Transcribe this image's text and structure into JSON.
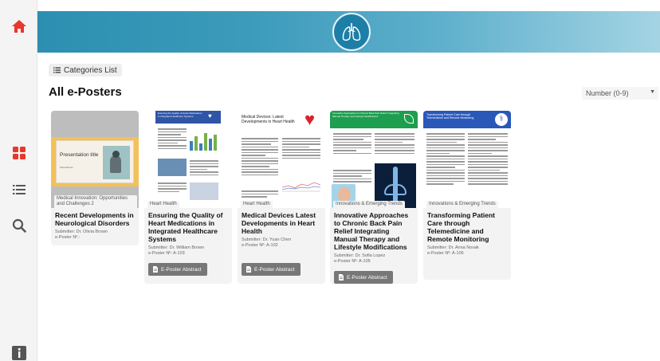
{
  "header": {
    "logo_icon": "lungs-icon"
  },
  "sidebar": {
    "home_icon": "home-icon",
    "grid_icon": "grid-view-icon",
    "list_icon": "list-view-icon",
    "search_icon": "search-icon",
    "info_icon": "info-icon"
  },
  "toolbar": {
    "categories_label": "Categories List"
  },
  "page": {
    "title": "All e-Posters"
  },
  "sort": {
    "selected": "Number (0-9)"
  },
  "posters": [
    {
      "category": "Medical Innovation: Opportunities and Challenges 2",
      "title": "Recent Developments in Neurological Disorders",
      "submitter": "Submitter: Dr. Olivia Brown",
      "number": "e-Poster Nº.:",
      "thumb_title": "Presentation title",
      "thumb_subtitle": "Olivia Brown",
      "has_abstract": false
    },
    {
      "category": "Heart Health",
      "title": "Ensuring the Quality of Heart Medications in Integrated Healthcare Systems",
      "submitter": "Submitter: Dr. William Brown",
      "number": "e-Poster Nº: A-103",
      "thumb_title": "Ensuring the Quality of Heart Medications in Integrated Healthcare Systems",
      "has_abstract": true,
      "abstract_label": "E-Poster Abstract"
    },
    {
      "category": "Heart Health",
      "title": "Medical Devices Latest Developments in Heart Health",
      "submitter": "Submitter: Dr. Yuan Chen",
      "number": "e-Poster Nº: A-102",
      "thumb_title": "Medical Devices: Latest Developments in Heart Health",
      "has_abstract": true,
      "abstract_label": "E-Poster Abstract"
    },
    {
      "category": "Innovations & Emerging Trends",
      "title": "Innovative Approaches to Chronic Back Pain Relief Integrating Manual Therapy and Lifestyle Modifications",
      "submitter": "Submitter: Dr. Sofia Lopez",
      "number": "e-Poster Nº: A-105",
      "thumb_title": "Innovative Approaches to Chronic Back Pain Relief: Integrating Manual Therapy and Lifestyle Modifications",
      "has_abstract": true,
      "abstract_label": "E-Poster Abstract"
    },
    {
      "category": "Innovations & Emerging Trends",
      "title": "Transforming Patient Care through Telemedicine and Remote Monitoring",
      "submitter": "Submitter: Dr. Anna Novak",
      "number": "e-Poster Nº: A-106",
      "thumb_title": "Transforming Patient Care through Telemedicine and Remote Monitoring",
      "has_abstract": false
    }
  ],
  "colors": {
    "accent_red": "#e8372c",
    "banner_blue": "#2c8fb1",
    "abstract_button": "#777777"
  }
}
